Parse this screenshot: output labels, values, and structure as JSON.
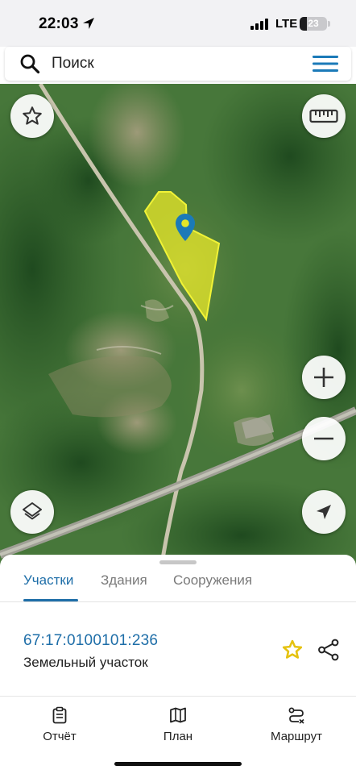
{
  "status_bar": {
    "time": "22:03",
    "network": "LTE",
    "battery": "23",
    "location_icon": "location-arrow-icon",
    "signal_icon": "cell-signal-icon"
  },
  "search": {
    "placeholder": "Поиск",
    "icon": "search-icon",
    "menu_icon": "hamburger-menu-icon"
  },
  "map": {
    "parcel_highlight_color": "#e4e629",
    "marker_color": "#1b7ab8",
    "controls": {
      "favorite_icon": "star-outline-icon",
      "ruler_icon": "ruler-icon",
      "zoom_in_icon": "plus-icon",
      "zoom_out_icon": "minus-icon",
      "layers_icon": "layers-icon",
      "location_icon": "navigation-arrow-icon"
    }
  },
  "sheet": {
    "tabs": [
      {
        "label": "Участки",
        "active": true
      },
      {
        "label": "Здания",
        "active": false
      },
      {
        "label": "Сооружения",
        "active": false
      }
    ],
    "parcel": {
      "number": "67:17:0100101:236",
      "type": "Земельный участок"
    },
    "accent_color": "#1e6ea8",
    "favorite_color": "#e5c210"
  },
  "bottom_nav": {
    "items": [
      {
        "label": "Отчёт",
        "icon": "report-clipboard-icon"
      },
      {
        "label": "План",
        "icon": "map-plan-icon"
      },
      {
        "label": "Маршрут",
        "icon": "route-icon"
      }
    ]
  }
}
